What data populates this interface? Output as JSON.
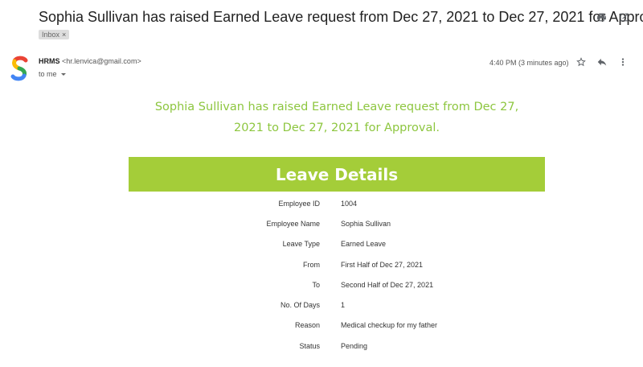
{
  "email": {
    "subject": "Sophia Sullivan has raised Earned Leave request from Dec 27, 2021 to Dec 27, 2021 for Approval",
    "label": "Inbox",
    "sender_name": "HRMS",
    "sender_email": "<hr.lenvica@gmail.com>",
    "to": "to me",
    "time": "4:40 PM (3 minutes ago)",
    "top_icons": [
      "print-icon",
      "open-in-new-window-icon"
    ],
    "header_icons": [
      "star-icon",
      "reply-icon",
      "more-icon"
    ]
  },
  "body": {
    "headline_line1": "Sophia Sullivan has raised Earned Leave request from Dec 27,",
    "headline_line2": "2021 to Dec 27, 2021 for Approval.",
    "banner_title": "Leave Details",
    "accent_color": "#a4cd39",
    "details": [
      {
        "label": "Employee ID",
        "value": "1004"
      },
      {
        "label": "Employee Name",
        "value": "Sophia Sullivan"
      },
      {
        "label": "Leave Type",
        "value": "Earned Leave"
      },
      {
        "label": "From",
        "value": "First Half of Dec 27, 2021"
      },
      {
        "label": "To",
        "value": "Second Half of Dec 27, 2021"
      },
      {
        "label": "No. Of Days",
        "value": "1"
      },
      {
        "label": "Reason",
        "value": "Medical checkup for my father"
      },
      {
        "label": "Status",
        "value": "Pending"
      }
    ]
  }
}
